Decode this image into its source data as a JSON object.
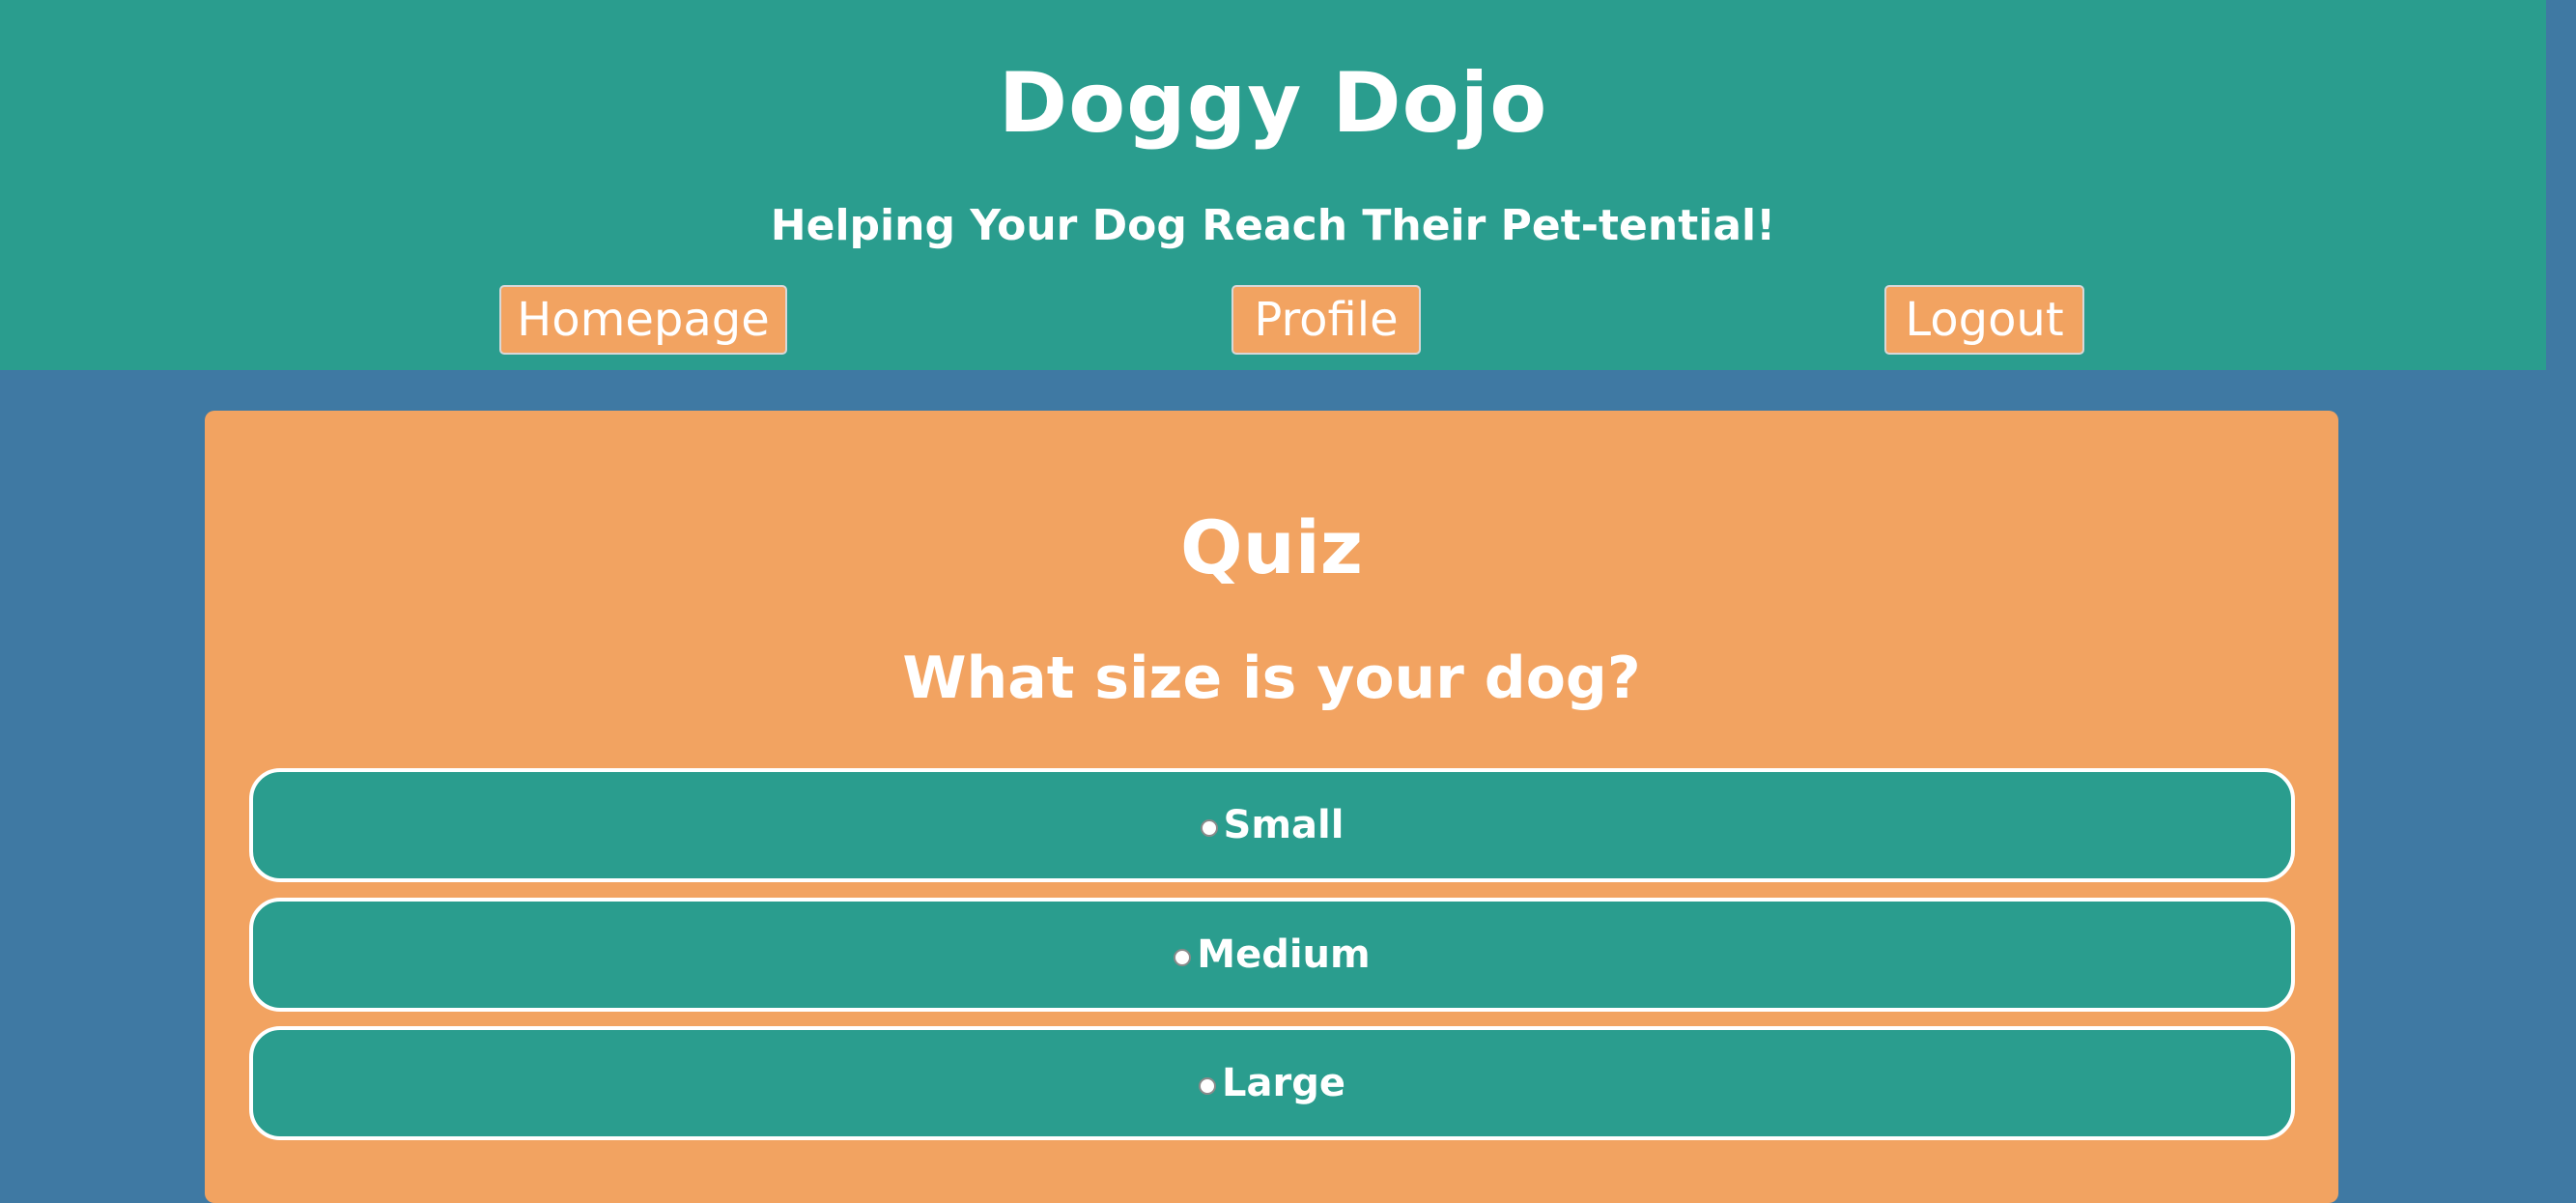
{
  "header": {
    "title": "Doggy Dojo",
    "tagline": "Helping Your Dog Reach Their Pet-tential!",
    "nav": {
      "homepage": "Homepage",
      "profile": "Profile",
      "logout": "Logout"
    }
  },
  "quiz": {
    "title": "Quiz",
    "question": "What size is your dog?",
    "options": [
      {
        "label": "Small",
        "selected": false
      },
      {
        "label": "Medium",
        "selected": false
      },
      {
        "label": "Large",
        "selected": false
      }
    ]
  },
  "colors": {
    "header_bg": "#2a9d8e",
    "page_bg": "#3f79a3",
    "accent_orange": "#f2a361",
    "text": "#ffffff"
  }
}
